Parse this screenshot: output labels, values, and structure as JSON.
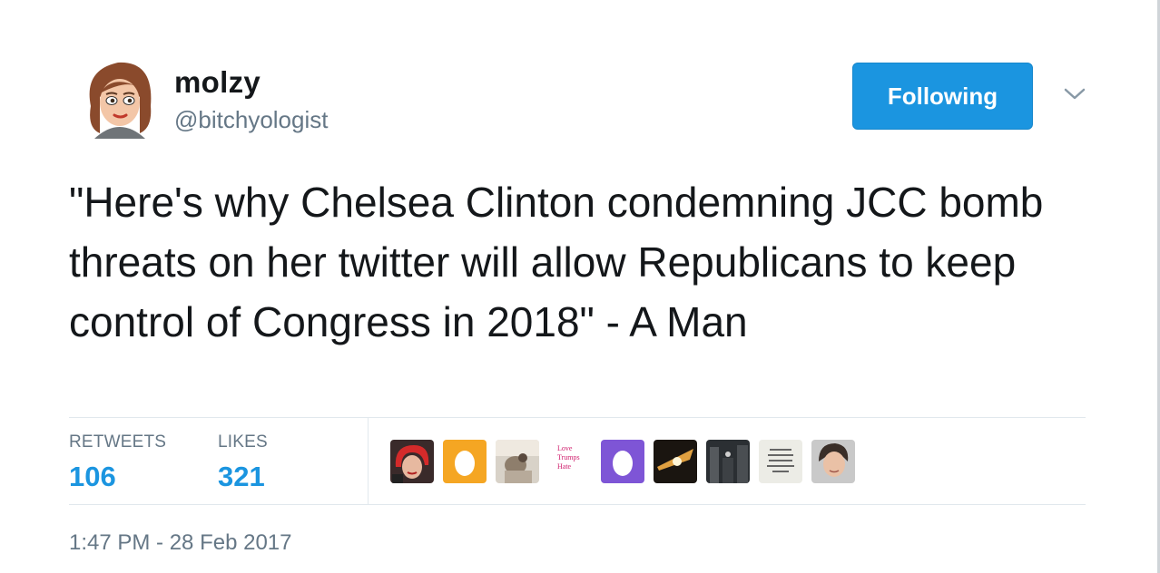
{
  "user": {
    "display_name": "molzy",
    "handle": "@bitchyologist"
  },
  "follow_button": {
    "label": "Following"
  },
  "tweet": {
    "text": "\"Here's why Chelsea Clinton condemning JCC bomb threats on her twitter will allow Republicans to keep control of Congress in 2018\" - A Man",
    "timestamp": "1:47 PM - 28 Feb 2017"
  },
  "stats": {
    "retweets_label": "RETWEETS",
    "retweets_count": "106",
    "likes_label": "LIKES",
    "likes_count": "321"
  },
  "likers": [
    {
      "icon": "red-hair-avatar"
    },
    {
      "icon": "egg-avatar",
      "color": "#f5a623"
    },
    {
      "icon": "photo-avatar"
    },
    {
      "icon": "text-avatar",
      "text": [
        "Love",
        "Trumps",
        "Hate"
      ],
      "color": "#d0206e"
    },
    {
      "icon": "egg-avatar",
      "color": "#7e55d6"
    },
    {
      "icon": "light-avatar"
    },
    {
      "icon": "street-avatar"
    },
    {
      "icon": "quote-avatar"
    },
    {
      "icon": "face-avatar"
    }
  ],
  "colors": {
    "accent": "#1b95e0",
    "text": "#14171a",
    "muted": "#657786"
  }
}
